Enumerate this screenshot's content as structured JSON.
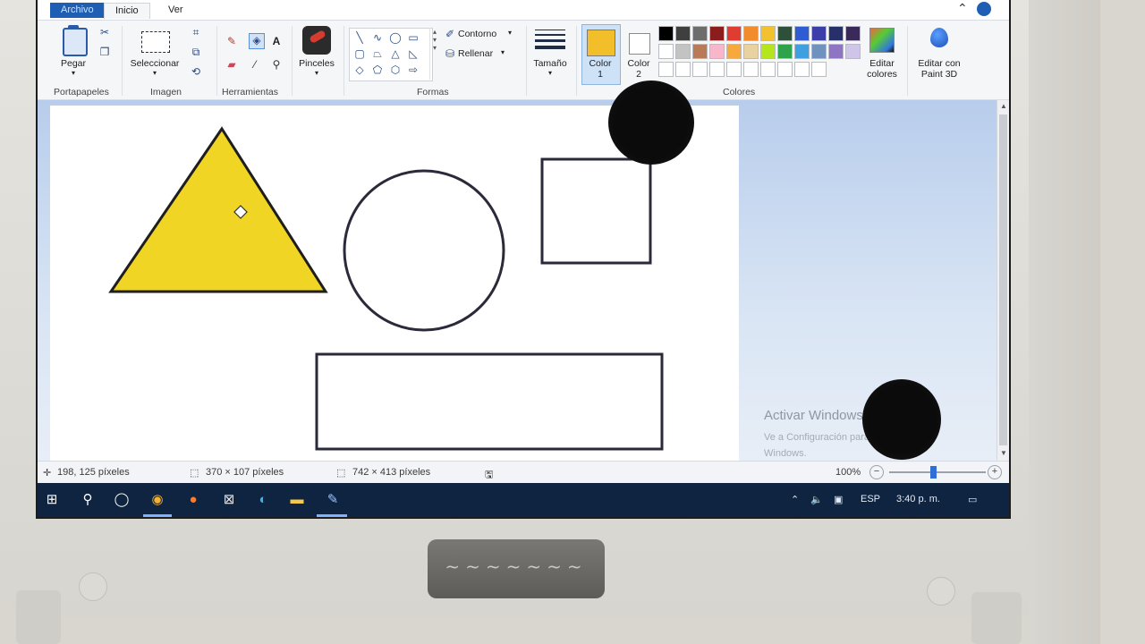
{
  "ribbon_tabs": {
    "file": "Archivo",
    "home": "Inicio",
    "view": "Ver"
  },
  "groups": {
    "clipboard": {
      "label": "Portapapeles",
      "paste": "Pegar"
    },
    "image": {
      "label": "Imagen",
      "select": "Seleccionar"
    },
    "tools": {
      "label": "Herramientas"
    },
    "brushes": {
      "label": "Pinceles"
    },
    "shapes": {
      "label": "Formas",
      "outline": "Contorno",
      "fill": "Rellenar"
    },
    "size": {
      "label": "Tamaño"
    },
    "colors": {
      "label": "Colores",
      "color1": "Color",
      "color1_num": "1",
      "color2": "Color",
      "color2_num": "2",
      "edit_colors_l1": "Editar",
      "edit_colors_l2": "colores",
      "paint3d_l1": "Editar con",
      "paint3d_l2": "Paint 3D",
      "color1_value": "#f2be2a",
      "color2_value": "#ffffff",
      "palette_row1": [
        "#000000",
        "#3f3f3f",
        "#6d6d6d",
        "#8b1d1d",
        "#e03c31",
        "#f28b2c",
        "#f2c12e",
        "#2e4f3a",
        "#2f5bd3",
        "#3c3fa8",
        "#27306b",
        "#3a2a5a"
      ],
      "palette_row2": [
        "#ffffff",
        "#c3c3c3",
        "#b97a57",
        "#f7b6c9",
        "#f7a93b",
        "#e8d3a0",
        "#b5e61d",
        "#2fa34b",
        "#3ea0e0",
        "#7092be",
        "#8f74c4",
        "#cfc5e8"
      ],
      "palette_row3": [
        "#ffffff",
        "#ffffff",
        "#ffffff",
        "#ffffff",
        "#ffffff",
        "#ffffff",
        "#ffffff",
        "#ffffff",
        "#ffffff",
        "#ffffff"
      ]
    }
  },
  "canvas": {
    "shapes": [
      {
        "kind": "triangle",
        "fill": "#f1d525",
        "stroke": "#1e1e1e"
      },
      {
        "kind": "circle",
        "fill": "none",
        "stroke": "#2a2a3a"
      },
      {
        "kind": "square",
        "fill": "none",
        "stroke": "#2a2a3a"
      },
      {
        "kind": "rectangle",
        "fill": "none",
        "stroke": "#2a2a3a"
      }
    ]
  },
  "watermark": {
    "title": "Activar Windows",
    "line1": "Ve a Configuración para activar",
    "line2": "Windows."
  },
  "status": {
    "cursor": "198, 125 píxeles",
    "selection": "370 × 107 píxeles",
    "canvas_size": "742 × 413 píxeles",
    "zoom": "100%"
  },
  "taskbar": {
    "language": "ESP",
    "time": "3:40 p. m."
  }
}
